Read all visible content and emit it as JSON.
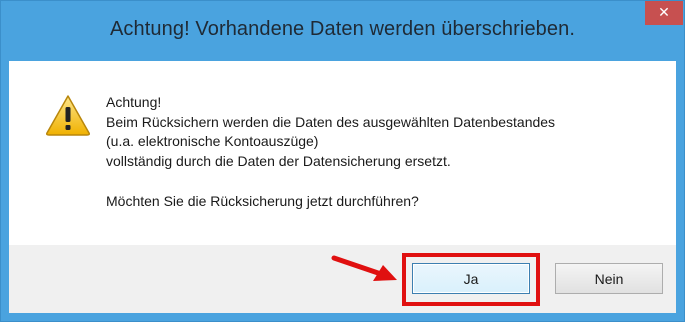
{
  "dialog": {
    "title": "Achtung! Vorhandene Daten werden überschrieben.",
    "close_label": "✕",
    "icon": "warning-icon",
    "message_lines": [
      "Achtung!",
      "Beim Rücksichern werden die Daten des ausgewählten Datenbestandes",
      "(u.a. elektronische Kontoauszüge)",
      "vollständig durch die Daten der Datensicherung ersetzt."
    ],
    "question": "Möchten Sie die Rücksicherung jetzt durchführen?"
  },
  "buttons": {
    "yes_label": "Ja",
    "no_label": "Nein"
  },
  "annotation": {
    "color": "#e01010",
    "arrow_icon": "red-arrow-icon"
  },
  "colors": {
    "titlebar": "#4aa3df",
    "close_button": "#c75050"
  }
}
